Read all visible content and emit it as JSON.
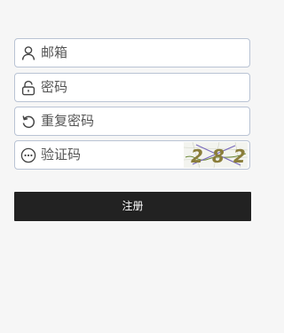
{
  "form": {
    "email": {
      "placeholder": "邮箱",
      "icon": "user-icon"
    },
    "password": {
      "placeholder": "密码",
      "icon": "lock-icon"
    },
    "repeat_password": {
      "placeholder": "重复密码",
      "icon": "refresh-icon"
    },
    "captcha": {
      "placeholder": "验证码",
      "icon": "more-dots-icon",
      "image_text": "282"
    },
    "register_label": "注册"
  },
  "colors": {
    "background": "#f6f6f6",
    "field_border": "#b9c3d4",
    "button_background": "#222222",
    "button_text": "#ffffff"
  }
}
